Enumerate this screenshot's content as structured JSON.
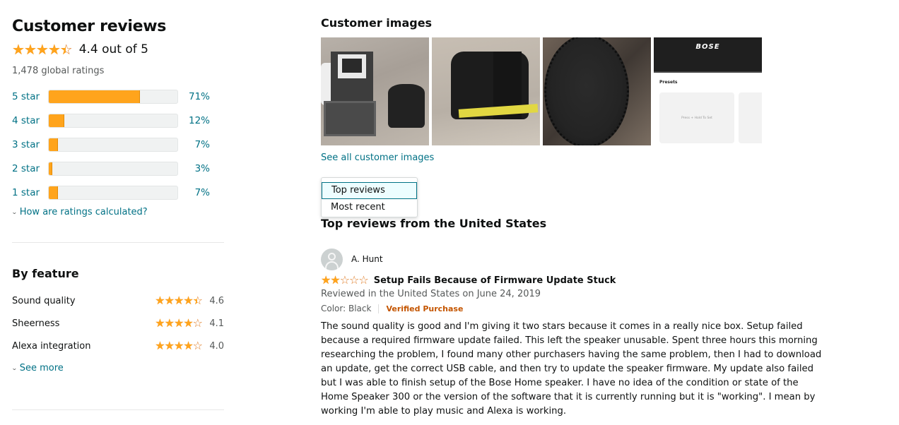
{
  "summary": {
    "title": "Customer reviews",
    "rating": 4.4,
    "rating_text": "4.4 out of 5",
    "global_ratings": "1,478 global ratings"
  },
  "histogram": [
    {
      "label": "5 star",
      "percent": 71,
      "percent_text": "71%"
    },
    {
      "label": "4 star",
      "percent": 12,
      "percent_text": "12%"
    },
    {
      "label": "3 star",
      "percent": 7,
      "percent_text": "7%"
    },
    {
      "label": "2 star",
      "percent": 3,
      "percent_text": "3%"
    },
    {
      "label": "1 star",
      "percent": 7,
      "percent_text": "7%"
    }
  ],
  "how_calculated": "How are ratings calculated?",
  "by_feature": {
    "title": "By feature",
    "items": [
      {
        "name": "Sound quality",
        "rating": 4.6,
        "rating_text": "4.6"
      },
      {
        "name": "Sheerness",
        "rating": 4.1,
        "rating_text": "4.1"
      },
      {
        "name": "Alexa integration",
        "rating": 4.0,
        "rating_text": "4.0"
      }
    ],
    "see_more": "See more"
  },
  "customer_images": {
    "title": "Customer images",
    "thumb_4": {
      "logo": "BOSE",
      "presets_label": "Presets",
      "card_text": "Press + Hold To Set"
    },
    "see_all": "See all customer images"
  },
  "sort_dropdown": {
    "options": [
      "Top reviews",
      "Most recent"
    ],
    "selected": "Top reviews"
  },
  "top_reviews_title": "Top reviews from the United States",
  "review": {
    "author": "A. Hunt",
    "rating": 2,
    "title": "Setup Fails Because of Firmware Update Stuck",
    "date": "Reviewed in the United States on June 24, 2019",
    "color": "Color: Black",
    "verified": "Verified Purchase",
    "body_lines": [
      "The sound quality is good and I'm giving it two stars because it comes in a really nice box. Setup failed",
      "because a required firmware update failed. This left the speaker unusable. Spent three hours this morning",
      "researching the problem, I found many other purchasers having the same problem, then I had to download",
      "an update, get the correct USB cable, and then try to update the speaker firmware. My update also failed",
      "but I was able to finish setup of the Bose Home speaker. I have no idea of the condition or state of the",
      "Home Speaker 300 or the version of the software that it is currently running but it is \"working\". I mean by",
      "working I'm able to play music and Alexa is working."
    ]
  },
  "colors": {
    "star": "#ffa41c",
    "star_outline": "#de7921",
    "link": "#007185",
    "verified": "#c45500"
  }
}
